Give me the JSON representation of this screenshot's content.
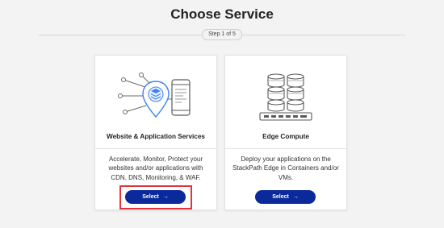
{
  "page": {
    "title": "Choose Service",
    "step": "Step 1 of 5"
  },
  "cards": [
    {
      "title": "Website & Application Services",
      "description": "Accelerate, Monitor, Protect your websites and/or applications with CDN, DNS, Monitoring, & WAF.",
      "button_label": "Select",
      "button_arrow": "→",
      "icon": "website-application-icon",
      "highlighted": true
    },
    {
      "title": "Edge Compute",
      "description": "Deploy your applications on the StackPath Edge in Containers and/or VMs.",
      "button_label": "Select",
      "button_arrow": "→",
      "icon": "server-stack-icon",
      "highlighted": false
    }
  ],
  "colors": {
    "background": "#f3f3f4",
    "button": "#0a2a9c",
    "highlight": "#e2343c",
    "icon_accent": "#3b82f6",
    "icon_line": "#555555"
  }
}
